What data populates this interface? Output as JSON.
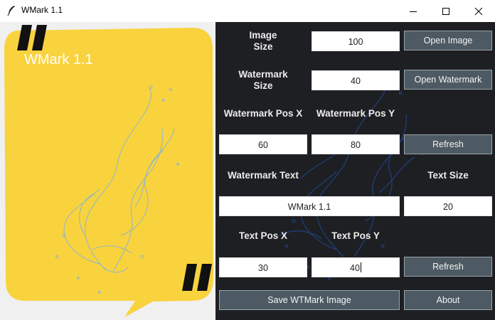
{
  "window": {
    "title": "WMark 1.1"
  },
  "preview": {
    "bubble_text": "WMark 1.1",
    "bubble_color": "#f9d33e",
    "quote_color": "#111111"
  },
  "labels": {
    "image_size": "Image\nSize",
    "watermark_size": "Watermark\nSize",
    "watermark_pos_x": "Watermark Pos X",
    "watermark_pos_y": "Watermark Pos Y",
    "watermark_text": "Watermark Text",
    "text_size": "Text Size",
    "text_pos_x": "Text Pos X",
    "text_pos_y": "Text Pos Y"
  },
  "fields": {
    "image_size": "100",
    "watermark_size": "40",
    "watermark_pos_x": "60",
    "watermark_pos_y": "80",
    "watermark_text": "WMark 1.1",
    "text_size": "20",
    "text_pos_x": "30",
    "text_pos_y": "40"
  },
  "buttons": {
    "open_image": "Open Image",
    "open_watermark": "Open Watermark",
    "refresh_watermark": "Refresh",
    "refresh_text": "Refresh",
    "save": "Save WTMark Image",
    "about": "About"
  },
  "colors": {
    "panel_bg": "#1e1f22",
    "button_bg": "#4d5a63",
    "accent_blue": "#1f4fa8"
  }
}
